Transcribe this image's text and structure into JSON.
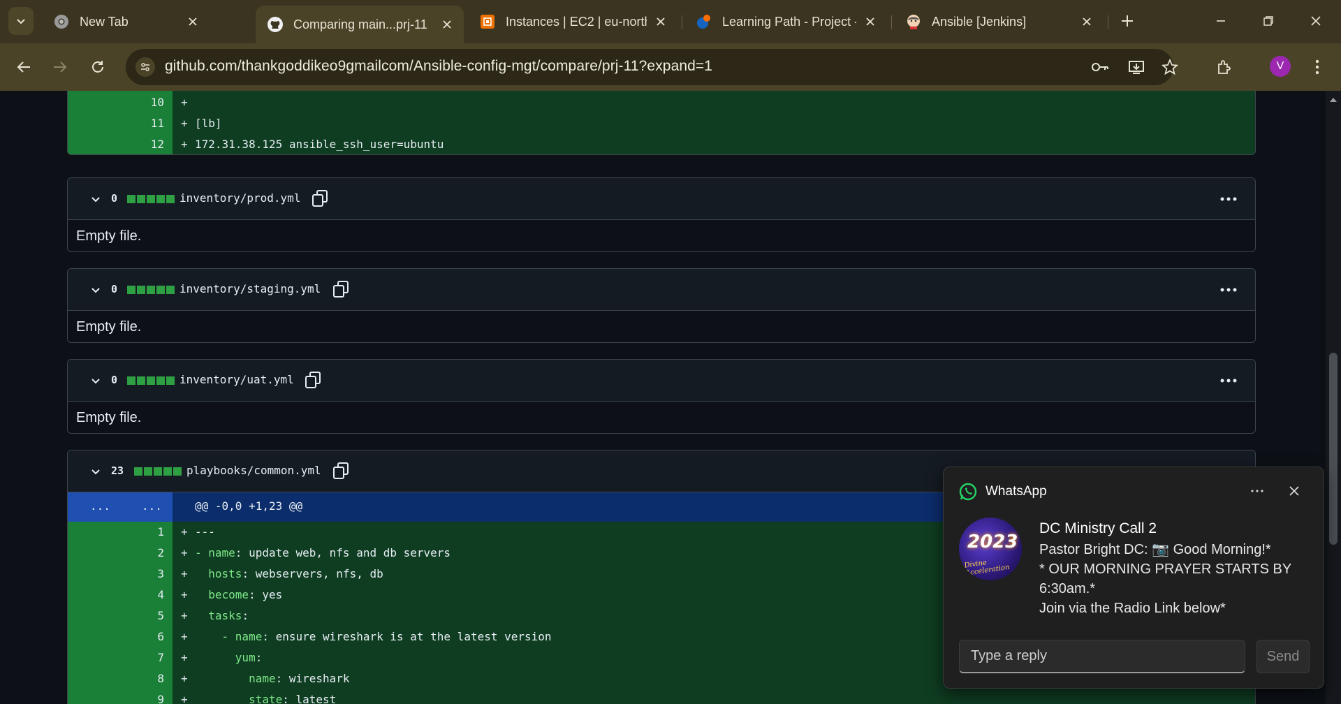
{
  "browser": {
    "tabs": [
      {
        "title": "New Tab",
        "icon": "chrome-icon"
      },
      {
        "title": "Comparing main...prj-11",
        "icon": "github-icon"
      },
      {
        "title": "Instances | EC2 | eu-north",
        "icon": "aws-icon"
      },
      {
        "title": "Learning Path - Project -",
        "icon": "learning-path-icon"
      },
      {
        "title": "Ansible [Jenkins]",
        "icon": "jenkins-icon"
      }
    ],
    "url": "github.com/thankgoddikeo9gmailcom/Ansible-config-mgt/compare/prj-11?expand=1",
    "profile_initial": "V"
  },
  "top_diff": {
    "lines": [
      {
        "num": "10",
        "text": ""
      },
      {
        "num": "11",
        "text": "[lb]"
      },
      {
        "num": "12",
        "text": "172.31.38.125 ansible_ssh_user=ubuntu"
      }
    ]
  },
  "files": [
    {
      "count": "0",
      "name": "inventory/prod.yml",
      "body": "Empty file."
    },
    {
      "count": "0",
      "name": "inventory/staging.yml",
      "body": "Empty file."
    },
    {
      "count": "0",
      "name": "inventory/uat.yml",
      "body": "Empty file."
    },
    {
      "count": "23",
      "name": "playbooks/common.yml"
    }
  ],
  "common_diff": {
    "hunk_dots_left": "...",
    "hunk_dots_right": "...",
    "hunk_header": "@@ -0,0 +1,23 @@",
    "lines": [
      {
        "num": "1",
        "text": "---"
      },
      {
        "num": "2",
        "key": "- name",
        "value": "update web, nfs and db servers"
      },
      {
        "num": "3",
        "key": "  hosts",
        "value": "webservers, nfs, db"
      },
      {
        "num": "4",
        "key": "  become",
        "value": "yes"
      },
      {
        "num": "5",
        "key": "  tasks",
        "value": ""
      },
      {
        "num": "6",
        "key": "    - name",
        "value": "ensure wireshark is at the latest version"
      },
      {
        "num": "7",
        "key": "      yum",
        "value": ""
      },
      {
        "num": "8",
        "key": "        name",
        "value": "wireshark"
      },
      {
        "num": "9",
        "key": "        state",
        "value": "latest"
      }
    ]
  },
  "whatsapp": {
    "app_name": "WhatsApp",
    "chat_title": "DC Ministry Call 2",
    "message": "Pastor Bright DC: 📷 Good Morning!*\n * OUR MORNING PRAYER  STARTS BY 6:30am.*\n Join via the Radio Link below*",
    "reply_placeholder": "Type a reply",
    "send_label": "Send",
    "avatar_text": "2023",
    "avatar_sub": "Divine Acceleration"
  },
  "colors": {
    "added_line_bg": "#0f3d22",
    "added_gutter_bg": "#1a7f37",
    "hunk_bg": "#0c2d6b",
    "diffstat_green": "#2ea043",
    "whatsapp_green": "#25d366"
  }
}
